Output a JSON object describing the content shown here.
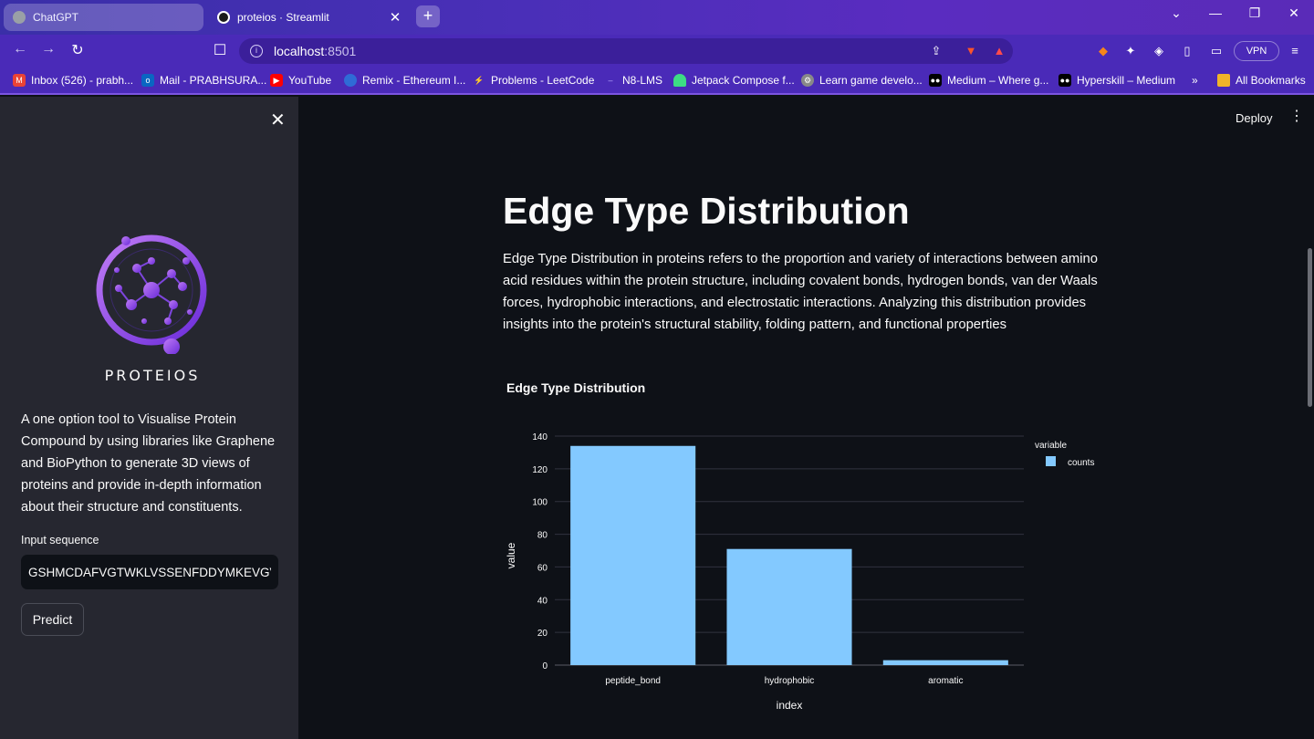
{
  "browser": {
    "tabs": [
      {
        "title": "ChatGPT"
      },
      {
        "title": "proteios · Streamlit"
      }
    ],
    "url_host": "localhost",
    "url_port": ":8501",
    "vpn_label": "VPN",
    "bookmarks": [
      {
        "label": "Inbox (526) - prabh...",
        "icon": "gmail-icon",
        "color": "#ea4335"
      },
      {
        "label": "Mail - PRABHSURA...",
        "icon": "outlook-icon",
        "color": "#0a66c2"
      },
      {
        "label": "YouTube",
        "icon": "youtube-icon",
        "color": "#ff0000"
      },
      {
        "label": "Remix - Ethereum I...",
        "icon": "remix-icon",
        "color": "#2f6bd6"
      },
      {
        "label": "Problems - LeetCode",
        "icon": "leetcode-icon",
        "color": "#b0b0b0"
      },
      {
        "label": "N8-LMS",
        "icon": "lms-icon",
        "color": "#6a5acd"
      },
      {
        "label": "Jetpack Compose f...",
        "icon": "android-icon",
        "color": "#3ddc84"
      },
      {
        "label": "Learn game develo...",
        "icon": "game-icon",
        "color": "#a0a0a0"
      },
      {
        "label": "Medium – Where g...",
        "icon": "medium-icon",
        "color": "#000000"
      },
      {
        "label": "Hyperskill – Medium",
        "icon": "medium-icon",
        "color": "#000000"
      }
    ],
    "bookmarks_overflow": "»",
    "all_bookmarks_label": "All Bookmarks"
  },
  "sidebar": {
    "brand": "PROTEIOS",
    "description": "A one option tool to Visualise Protein Compound by using libraries like Graphene and BioPython to generate 3D views of proteins and provide in-depth information about their structure and constituents.",
    "input_label": "Input sequence",
    "input_value": "GSHMCDAFVGTWKLVSSENFDDYMKEVGVGFATRKVAGMAKPNMIISVNGDVITIKSESTFKNTEISFILGQEFDEVTADDRKVKSTITLDGGVLVHVQKWDGKSTTIKRKREDDKLVVECVMKGVTSTRVYERA",
    "predict_label": "Predict"
  },
  "header": {
    "deploy_label": "Deploy"
  },
  "main": {
    "title": "Edge Type Distribution",
    "paragraph": "Edge Type Distribution in proteins refers to the proportion and variety of interactions between amino acid residues within the protein structure, including covalent bonds, hydrogen bonds, van der Waals forces, hydrophobic interactions, and electrostatic interactions. Analyzing this distribution provides insights into the protein's structural stability, folding pattern, and functional properties"
  },
  "chart_data": {
    "type": "bar",
    "title": "Edge Type Distribution",
    "categories": [
      "peptide_bond",
      "hydrophobic",
      "aromatic"
    ],
    "series": [
      {
        "name": "counts",
        "values": [
          134,
          71,
          3
        ],
        "color": "#83c9ff"
      }
    ],
    "xlabel": "index",
    "ylabel": "value",
    "ylim": [
      0,
      140
    ],
    "yticks": [
      0,
      20,
      40,
      60,
      80,
      100,
      120,
      140
    ],
    "legend_title": "variable",
    "legend_position": "top-right",
    "grid": true
  },
  "colors": {
    "sidebar_bg": "#262730",
    "main_bg": "#0e1117",
    "bar": "#83c9ff",
    "browser_accent": "#4a2ab8"
  }
}
